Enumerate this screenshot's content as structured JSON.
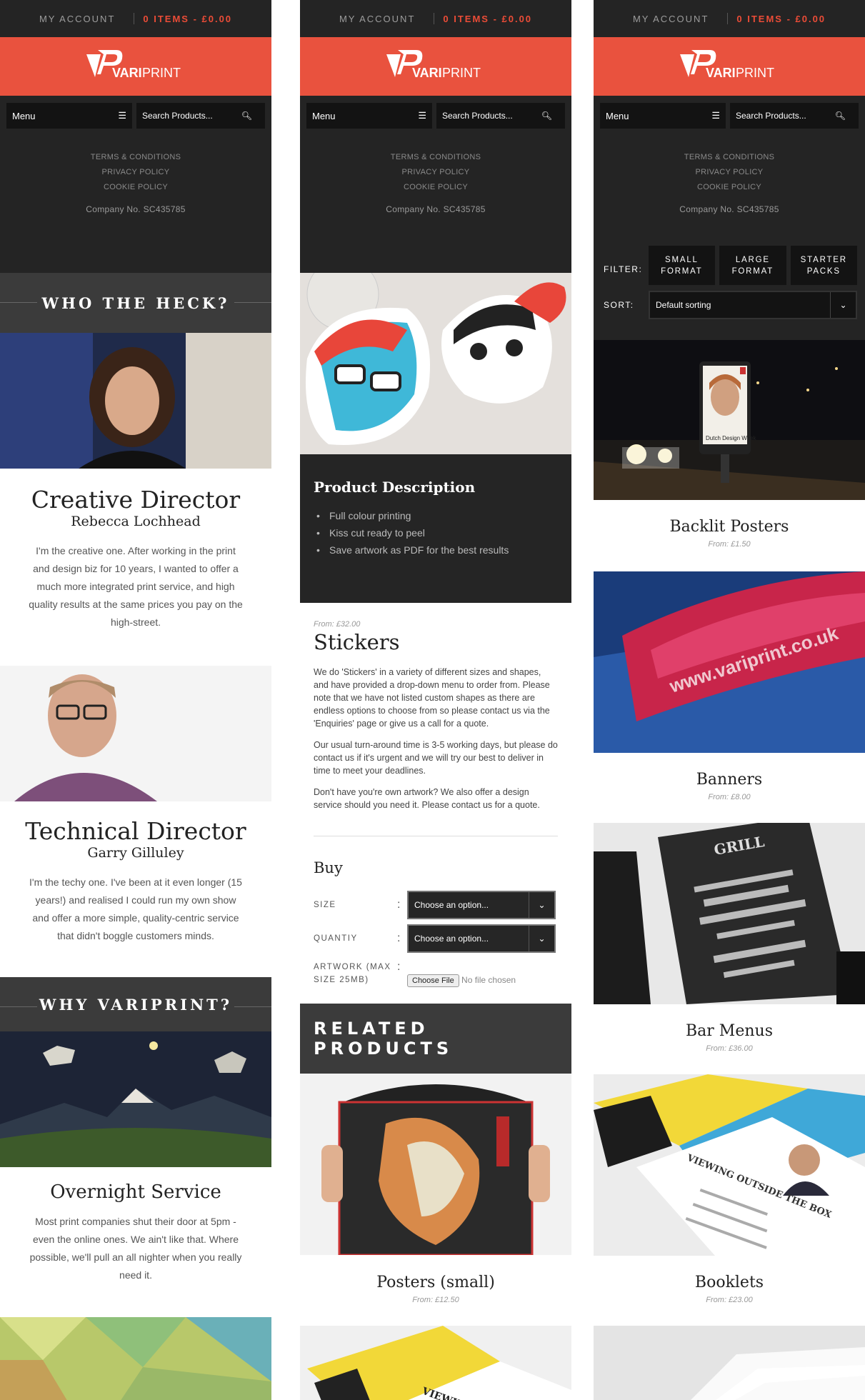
{
  "header": {
    "account_label": "MY ACCOUNT",
    "cart_label": "0 ITEMS - £0.00",
    "brand_a": "VARI",
    "brand_b": "PRINT",
    "menu_label": "Menu",
    "search_placeholder": "Search Products...",
    "links": [
      "TERMS & CONDITIONS",
      "PRIVACY POLICY",
      "COOKIE POLICY"
    ],
    "company": "Company No. SC435785"
  },
  "about": {
    "heading": "WHO THE HECK?",
    "people": [
      {
        "role": "Creative Director",
        "name": "Rebecca Lochhead",
        "bio": "I'm the creative one. After working in the print and design biz for 10 years, I wanted to offer a much more integrated print service, and high quality results at the same prices you pay on the high-street."
      },
      {
        "role": "Technical Director",
        "name": "Garry Gilluley",
        "bio": "I'm the techy one. I've been at it even longer (15 years!) and realised I could run my own show and offer a more simple, quality-centric service that didn't boggle customers minds."
      }
    ],
    "why_heading": "WHY VARIPRINT?",
    "feature": {
      "title": "Overnight Service",
      "text": "Most print companies shut their door at 5pm - even the online ones. We ain't like that. Where possible, we'll pull an all nighter when you really need it."
    }
  },
  "product": {
    "desc_heading": "Product Description",
    "bullets": [
      "Full colour printing",
      "Kiss cut ready to peel",
      "Save artwork as PDF for the best results"
    ],
    "from": "From: £32.00",
    "title": "Stickers",
    "paragraphs": [
      "We do 'Stickers' in a variety of different sizes and shapes, and have provided a drop-down menu to order from. Please note that we have not listed custom shapes as there are endless options to choose from so please contact us via the 'Enquiries' page or give us a call for a quote.",
      "Our usual turn-around time is 3-5 working days, but please do contact us if it's urgent and we will try our best to deliver in time to meet your deadlines.",
      "Don't have you're own artwork? We also offer a design service should you need it. Please contact us for a quote."
    ],
    "buy_heading": "Buy",
    "size_label": "SIZE",
    "quantity_label": "QUANTIY",
    "select_placeholder": "Choose an option...",
    "artwork_label": "ARTWORK (MAX SIZE 25MB)",
    "file_button": "Choose File",
    "file_status": "No file chosen",
    "related_heading": "RELATED PRODUCTS",
    "related": [
      {
        "title": "Posters (small)",
        "from": "From: £12.50"
      }
    ]
  },
  "shop": {
    "filter_label": "FILTER:",
    "filters": [
      "SMALL FORMAT",
      "LARGE FORMAT",
      "STARTER PACKS"
    ],
    "sort_label": "SORT:",
    "sort_value": "Default sorting",
    "poster_caption": "Dutch Design Week",
    "products": [
      {
        "title": "Backlit Posters",
        "from": "From: £1.50"
      },
      {
        "title": "Banners",
        "from": "From: £8.00"
      },
      {
        "title": "Bar Menus",
        "from": "From: £36.00"
      },
      {
        "title": "Booklets",
        "from": "From: £23.00"
      }
    ],
    "banner_text": "www.variprint.co.uk",
    "menu_logo": "GRILL",
    "booklet_text": "VIEWING OUTSIDE THE BOX"
  },
  "colors": {
    "brand": "#e9523e",
    "dark": "#242424",
    "accent": "#ec4c37"
  }
}
